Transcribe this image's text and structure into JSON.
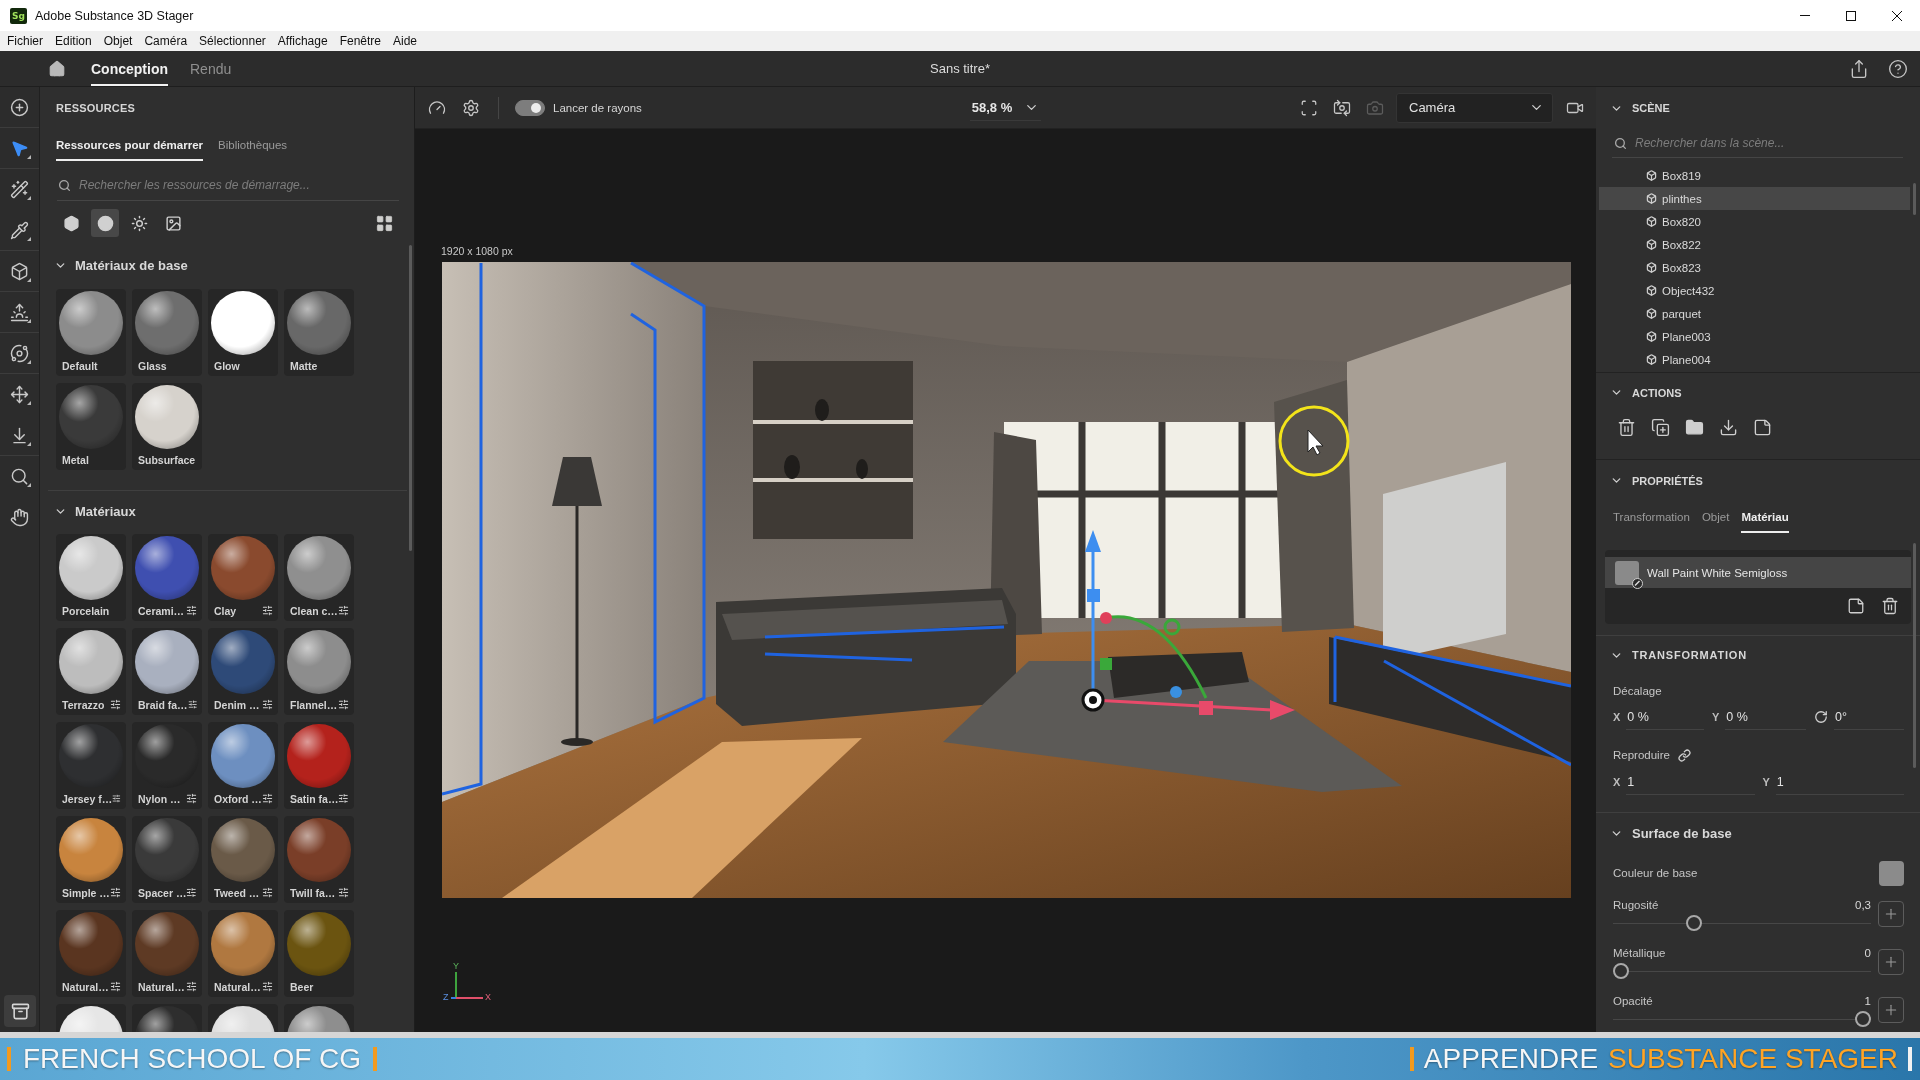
{
  "window": {
    "app_badge": "Sg",
    "title": "Adobe Substance 3D Stager"
  },
  "menu": [
    "Fichier",
    "Edition",
    "Objet",
    "Caméra",
    "Sélectionner",
    "Affichage",
    "Fenêtre",
    "Aide"
  ],
  "header": {
    "tabs": [
      {
        "label": "Conception",
        "selected": true
      },
      {
        "label": "Rendu",
        "selected": false
      }
    ],
    "document_title": "Sans titre*"
  },
  "tools": [
    {
      "kind": "add",
      "selected": false
    },
    {
      "kind": "select",
      "selected": true
    },
    {
      "kind": "wand",
      "selected": false
    },
    {
      "kind": "eyedropper",
      "selected": false
    },
    {
      "kind": "object",
      "selected": false
    },
    {
      "kind": "light",
      "selected": false
    },
    {
      "kind": "orbit",
      "selected": false
    },
    {
      "kind": "move",
      "selected": false
    },
    {
      "kind": "drop",
      "selected": false
    },
    {
      "kind": "zoom",
      "selected": false
    },
    {
      "kind": "pan",
      "selected": false
    }
  ],
  "resources": {
    "title": "RESSOURCES",
    "tabs": [
      {
        "label": "Ressources pour démarrer",
        "selected": true
      },
      {
        "label": "Bibliothèques",
        "selected": false
      }
    ],
    "search": {
      "placeholder": "Rechercher les ressources de démarrage..."
    },
    "categories": [
      {
        "kind": "models",
        "selected": false
      },
      {
        "kind": "materials",
        "selected": true
      },
      {
        "kind": "lights",
        "selected": false
      },
      {
        "kind": "images",
        "selected": false
      }
    ],
    "sections": [
      {
        "title": "Matériaux de base",
        "expanded": true,
        "items": [
          {
            "name": "Default",
            "color": "#8c8c8c",
            "adjustable": false
          },
          {
            "name": "Glass",
            "color": "#6e6e6e",
            "adjustable": false
          },
          {
            "name": "Glow",
            "color": "#ffffff",
            "adjustable": false
          },
          {
            "name": "Matte",
            "color": "#686868",
            "adjustable": false
          },
          {
            "name": "Metal",
            "color": "#3a3a3a",
            "adjustable": false
          },
          {
            "name": "Subsurface",
            "color": "#d6d2cc",
            "adjustable": false
          }
        ]
      },
      {
        "title": "Matériaux",
        "expanded": true,
        "items": [
          {
            "name": "Porcelain",
            "color": "#cacaca",
            "adjustable": false
          },
          {
            "name": "Cerami…",
            "color": "#3f4fb0",
            "adjustable": true
          },
          {
            "name": "Clay",
            "color": "#8a4a2e",
            "adjustable": true
          },
          {
            "name": "Clean c…",
            "color": "#8f8f8f",
            "adjustable": true
          },
          {
            "name": "Terrazzo",
            "color": "#bdbdbd",
            "adjustable": true
          },
          {
            "name": "Braid fa…",
            "color": "#a9b0bf",
            "adjustable": true
          },
          {
            "name": "Denim …",
            "color": "#2e4a78",
            "adjustable": true
          },
          {
            "name": "Flannel…",
            "color": "#8d8d8d",
            "adjustable": true
          },
          {
            "name": "Jersey f…",
            "color": "#2e2f31",
            "adjustable": true
          },
          {
            "name": "Nylon …",
            "color": "#2a2a2a",
            "adjustable": true
          },
          {
            "name": "Oxford …",
            "color": "#6d8fc0",
            "adjustable": true
          },
          {
            "name": "Satin fa…",
            "color": "#b4221c",
            "adjustable": true
          },
          {
            "name": "Simple …",
            "color": "#c8843e",
            "adjustable": true
          },
          {
            "name": "Spacer …",
            "color": "#3a3a3a",
            "adjustable": true
          },
          {
            "name": "Tweed …",
            "color": "#6a5a48",
            "adjustable": true
          },
          {
            "name": "Twill fa…",
            "color": "#7a3e28",
            "adjustable": true
          },
          {
            "name": "Natural…",
            "color": "#5a3520",
            "adjustable": true
          },
          {
            "name": "Natural…",
            "color": "#5e3a24",
            "adjustable": true
          },
          {
            "name": "Natural…",
            "color": "#b07840",
            "adjustable": true
          },
          {
            "name": "Beer",
            "color": "#6b5410",
            "adjustable": false
          },
          {
            "color": "#e6e6e6"
          },
          {
            "color": "#2e2e2e"
          },
          {
            "color": "#dedede"
          },
          {
            "color": "#8e8e8e"
          }
        ]
      }
    ]
  },
  "viewport": {
    "toolbar": {
      "raytracing": {
        "label": "Lancer de rayons",
        "on": true
      },
      "zoom": "58,8 %",
      "camera_tools": [
        {
          "kind": "frame",
          "disabled": false
        },
        {
          "kind": "switch",
          "disabled": false
        },
        {
          "kind": "save",
          "disabled": true
        }
      ],
      "camera": "Caméra"
    },
    "resolution": "1920 x 1080 px",
    "axes": {
      "y": "Y",
      "z": "Z",
      "x": "X"
    }
  },
  "scene": {
    "title": "SCÈNE",
    "expanded": true,
    "search": {
      "placeholder": "Rechercher dans la scène..."
    },
    "items": [
      {
        "name": "Box819",
        "selected": false
      },
      {
        "name": "plinthes",
        "selected": true
      },
      {
        "name": "Box820",
        "selected": false
      },
      {
        "name": "Box822",
        "selected": false
      },
      {
        "name": "Box823",
        "selected": false
      },
      {
        "name": "Object432",
        "selected": false
      },
      {
        "name": "parquet",
        "selected": false
      },
      {
        "name": "Plane003",
        "selected": false
      },
      {
        "name": "Plane004",
        "selected": false
      }
    ]
  },
  "actions": {
    "title": "ACTIONS",
    "expanded": true,
    "buttons": [
      {
        "kind": "delete"
      },
      {
        "kind": "duplicate"
      },
      {
        "kind": "group"
      },
      {
        "kind": "export"
      },
      {
        "kind": "apply"
      }
    ]
  },
  "properties": {
    "title": "PROPRIÉTÉS",
    "expanded": true,
    "tabs": [
      {
        "label": "Transformation",
        "selected": false
      },
      {
        "label": "Objet",
        "selected": false
      },
      {
        "label": "Matériau",
        "selected": true
      }
    ],
    "material": {
      "name": "Wall Paint White Semigloss",
      "color": "#8a8a8a"
    },
    "transformation": {
      "title": "TRANSFORMATION",
      "expanded": true,
      "offset": {
        "label": "Décalage",
        "fields": [
          {
            "kind": "axis",
            "label": "X",
            "value": "0 %"
          },
          {
            "kind": "axis",
            "label": "Y",
            "value": "0 %"
          },
          {
            "kind": "rotation",
            "value": "0°"
          }
        ]
      },
      "tiling": {
        "label": "Reproduire",
        "linked": true,
        "fields": [
          {
            "kind": "axis",
            "label": "X",
            "value": "1"
          },
          {
            "kind": "axis",
            "label": "Y",
            "value": "1"
          }
        ]
      }
    },
    "base_surface": {
      "title": "Surface de base",
      "expanded": true,
      "base_color": {
        "label": "Couleur de base",
        "color": "#8b8b8b"
      },
      "sliders": [
        {
          "label": "Rugosité",
          "reading": "0,3",
          "level": 0.3
        },
        {
          "label": "Métallique",
          "reading": "0",
          "level": 0
        },
        {
          "label": "Opacité",
          "reading": "1",
          "level": 1
        }
      ]
    }
  },
  "banner": {
    "left": "FRENCH SCHOOL OF CG",
    "right_lead": "APPRENDRE",
    "right_highlight": "SUBSTANCE STAGER"
  }
}
